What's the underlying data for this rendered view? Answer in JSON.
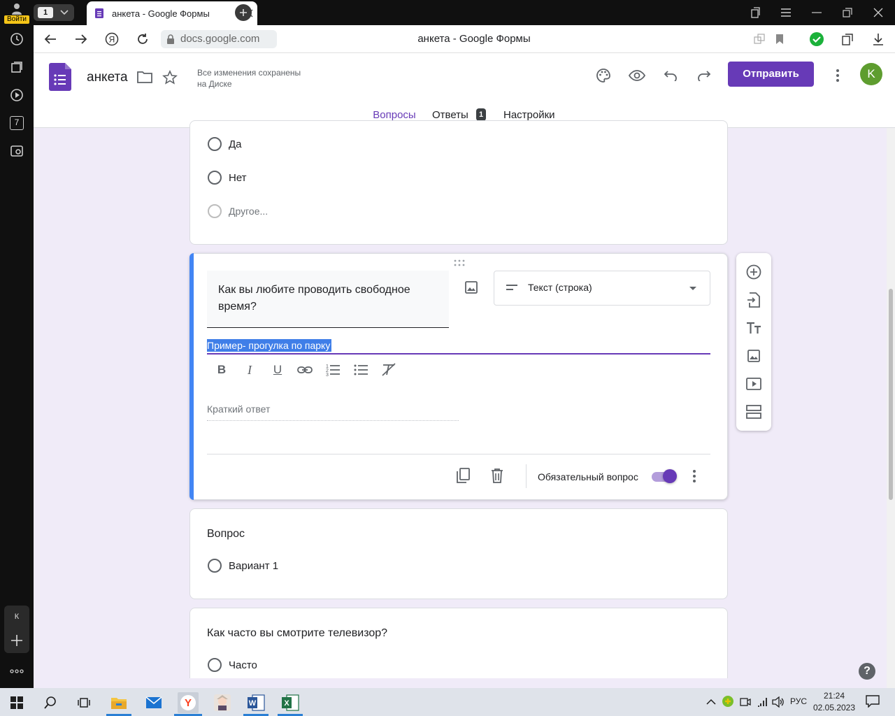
{
  "browser": {
    "login_label": "Войти",
    "tab_counter": "1",
    "tab_title": "анкета - Google Формы",
    "url": "docs.google.com",
    "page_title": "анкета - Google Формы",
    "sidebar_counter": "7",
    "profile_letter": "К"
  },
  "forms": {
    "doc_title": "анкета",
    "save_status_line1": "Все изменения сохранены",
    "save_status_line2": "на Диске",
    "send_label": "Отправить",
    "avatar_letter": "K",
    "tabs": [
      {
        "label": "Вопросы",
        "active": true
      },
      {
        "label": "Ответы",
        "badge": "1"
      },
      {
        "label": "Настройки"
      }
    ]
  },
  "card1": {
    "options": [
      "Да",
      "Нет",
      "Другое..."
    ]
  },
  "card2": {
    "question": "Как вы любите проводить свободное время?",
    "type_label": "Текст (строка)",
    "description": "Пример- прогулка по парку",
    "answer_placeholder": "Краткий ответ",
    "required_label": "Обязательный вопрос",
    "required": true
  },
  "card3": {
    "question": "Вопрос",
    "options": [
      "Вариант 1"
    ]
  },
  "card4": {
    "question": "Как часто вы смотрите телевизор?",
    "options": [
      "Часто"
    ]
  },
  "taskbar": {
    "lang": "РУС",
    "time": "21:24",
    "date": "02.05.2023"
  },
  "colors": {
    "accent": "#673ab7",
    "selection": "#3f7ee8",
    "active_tab": "#673ab7"
  }
}
